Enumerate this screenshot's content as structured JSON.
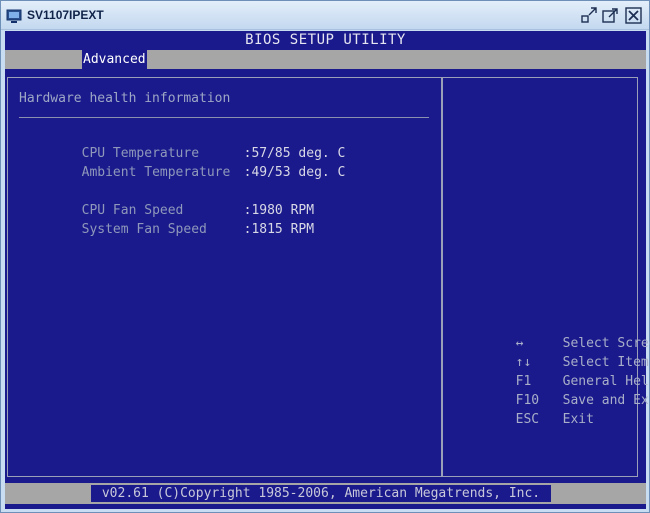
{
  "window": {
    "title": "SV1107IPEXT",
    "icon": "app-icon",
    "buttons": [
      "restore-icon",
      "maximize-icon",
      "close-icon"
    ]
  },
  "bios": {
    "title": "BIOS SETUP UTILITY",
    "menu": {
      "active_tab": "Advanced"
    },
    "section_title": "Hardware health information",
    "readings": [
      {
        "label": "CPU Temperature",
        "value": ":57/85 deg. C"
      },
      {
        "label": "Ambient Temperature",
        "value": ":49/53 deg. C"
      },
      {
        "label": "CPU Fan Speed",
        "value": ":1980 RPM"
      },
      {
        "label": "System Fan Speed",
        "value": ":1815 RPM"
      }
    ],
    "help": [
      {
        "key": "↔",
        "desc": "Select Screen"
      },
      {
        "key": "↑↓",
        "desc": "Select Item"
      },
      {
        "key": "F1",
        "desc": "General Help"
      },
      {
        "key": "F10",
        "desc": "Save and Exit"
      },
      {
        "key": "ESC",
        "desc": "Exit"
      }
    ],
    "footer": "v02.61 (C)Copyright 1985-2006, American Megatrends, Inc."
  },
  "colors": {
    "bios_background": "#1a1a8c",
    "bar_gray": "#a6a6a6",
    "label_text": "#8f98ba",
    "value_text": "#d8d8e6"
  }
}
